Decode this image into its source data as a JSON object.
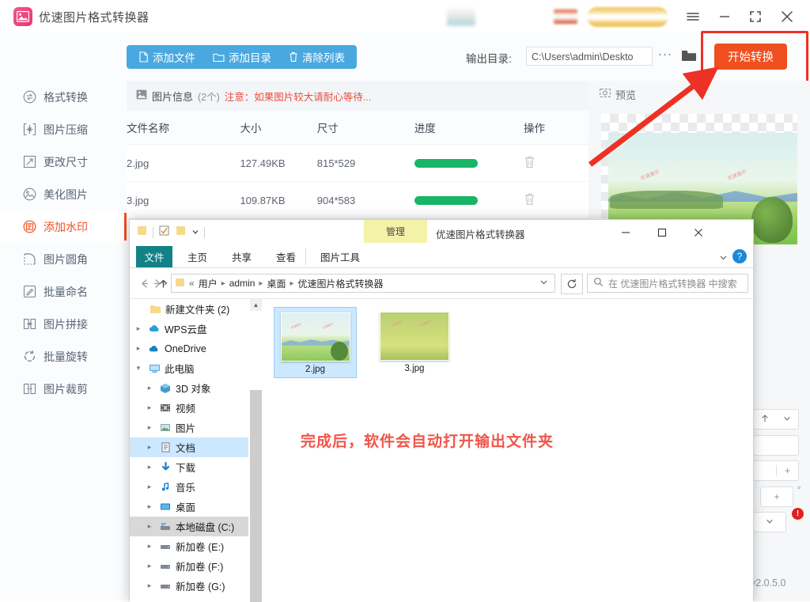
{
  "app": {
    "title": "优速图片格式转换器",
    "version": "v2.0.5.0",
    "logo_icon": "image-logo-icon",
    "window_buttons": {
      "menu": "hamburger-menu-icon",
      "minimize": "minimize-icon",
      "maximize": "maximize-icon",
      "close": "close-icon"
    }
  },
  "toolbar": {
    "add_file": "添加文件",
    "add_file_icon": "file-icon",
    "add_folder": "添加目录",
    "add_folder_icon": "folder-icon",
    "clear_list": "清除列表",
    "clear_list_icon": "trash-icon",
    "output_label": "输出目录:",
    "output_path": "C:\\Users\\admin\\Deskto",
    "more_dots": "···",
    "browse_icon": "folder-open-icon",
    "convert_button": "开始转换",
    "convert_color": "#f04f20"
  },
  "sidebar": {
    "items": [
      {
        "label": "格式转换",
        "icon": "convert-icon",
        "active": false
      },
      {
        "label": "图片压缩",
        "icon": "compress-icon",
        "active": false
      },
      {
        "label": "更改尺寸",
        "icon": "resize-icon",
        "active": false
      },
      {
        "label": "美化图片",
        "icon": "beautify-icon",
        "active": false
      },
      {
        "label": "添加水印",
        "icon": "watermark-icon",
        "active": true
      },
      {
        "label": "图片圆角",
        "icon": "round-corner-icon",
        "active": false
      },
      {
        "label": "批量命名",
        "icon": "rename-icon",
        "active": false
      },
      {
        "label": "图片拼接",
        "icon": "stitch-icon",
        "active": false
      },
      {
        "label": "批量旋转",
        "icon": "rotate-icon",
        "active": false
      },
      {
        "label": "图片裁剪",
        "icon": "crop-icon",
        "active": false
      }
    ]
  },
  "main": {
    "info_icon": "image-info-icon",
    "info_title": "图片信息",
    "info_count": "(2个)",
    "info_warning": "注意：如果图片较大请耐心等待...",
    "columns": [
      "文件名称",
      "大小",
      "尺寸",
      "进度",
      "操作"
    ],
    "rows": [
      {
        "name": "2.jpg",
        "size": "127.49KB",
        "dimension": "815*529",
        "progress": 100,
        "action_icon": "trash-icon"
      },
      {
        "name": "3.jpg",
        "size": "109.87KB",
        "dimension": "904*583",
        "progress": 100,
        "action_icon": "trash-icon"
      }
    ]
  },
  "preview": {
    "icon": "preview-icon",
    "title": "预览",
    "watermark_text": "优速图片"
  },
  "explorer": {
    "window_title": "优速图片格式转换器",
    "contextual_tab": "管理",
    "quick_access_icons": [
      "folder-icon",
      "checkbox-icon",
      "folder-icon",
      "chevron-down-icon"
    ],
    "window_buttons": {
      "minimize": "minimize-icon",
      "maximize": "maximize-icon",
      "close": "close-icon"
    },
    "tabs": [
      "文件",
      "主页",
      "共享",
      "查看",
      "图片工具"
    ],
    "help_icon": "help-icon",
    "collapse_icon": "chevron-down-icon",
    "nav": {
      "back": "back-arrow-icon",
      "forward": "forward-arrow-icon",
      "recent": "chevron-down-icon",
      "up": "up-arrow-icon"
    },
    "breadcrumb": [
      "用户",
      "admin",
      "桌面",
      "优速图片格式转换器"
    ],
    "breadcrumb_prefix": "«",
    "refresh_icon": "refresh-icon",
    "search_placeholder": "在 优速图片格式转换器 中搜索",
    "search_icon": "search-icon",
    "tree": [
      {
        "label": "新建文件夹 (2)",
        "icon": "folder-icon",
        "caret": false,
        "indent": 1,
        "state": "none"
      },
      {
        "label": "WPS云盘",
        "icon": "cloud-icon",
        "caret": "right",
        "indent": 0,
        "state": "none"
      },
      {
        "label": "OneDrive",
        "icon": "onedrive-icon",
        "caret": "right",
        "indent": 0,
        "state": "none"
      },
      {
        "label": "此电脑",
        "icon": "computer-icon",
        "caret": "down",
        "indent": 0,
        "state": "none"
      },
      {
        "label": "3D 对象",
        "icon": "3dobject-icon",
        "caret": "right",
        "indent": 1,
        "state": "none"
      },
      {
        "label": "视频",
        "icon": "video-icon",
        "caret": "right",
        "indent": 1,
        "state": "none"
      },
      {
        "label": "图片",
        "icon": "picture-icon",
        "caret": "right",
        "indent": 1,
        "state": "none"
      },
      {
        "label": "文档",
        "icon": "document-icon",
        "caret": "right",
        "indent": 1,
        "state": "selected"
      },
      {
        "label": "下载",
        "icon": "download-icon",
        "caret": "right",
        "indent": 1,
        "state": "none"
      },
      {
        "label": "音乐",
        "icon": "music-icon",
        "caret": "right",
        "indent": 1,
        "state": "none"
      },
      {
        "label": "桌面",
        "icon": "desktop-icon",
        "caret": "right",
        "indent": 1,
        "state": "none"
      },
      {
        "label": "本地磁盘 (C:)",
        "icon": "drive-c-icon",
        "caret": "right",
        "indent": 1,
        "state": "hover"
      },
      {
        "label": "新加卷 (E:)",
        "icon": "drive-icon",
        "caret": "right",
        "indent": 1,
        "state": "none"
      },
      {
        "label": "新加卷 (F:)",
        "icon": "drive-icon",
        "caret": "right",
        "indent": 1,
        "state": "none"
      },
      {
        "label": "新加卷 (G:)",
        "icon": "drive-icon",
        "caret": "right",
        "indent": 1,
        "state": "none"
      }
    ],
    "files": [
      {
        "name": "2.jpg",
        "selected": true
      },
      {
        "name": "3.jpg",
        "selected": false
      }
    ]
  },
  "annotations": {
    "callout_text": "完成后，软件会自动打开输出文件夹",
    "callout_color": "#f0554a",
    "highlight_color": "#ee3124",
    "arrow_name": "red-arrow-pointing-to-convert-button"
  }
}
